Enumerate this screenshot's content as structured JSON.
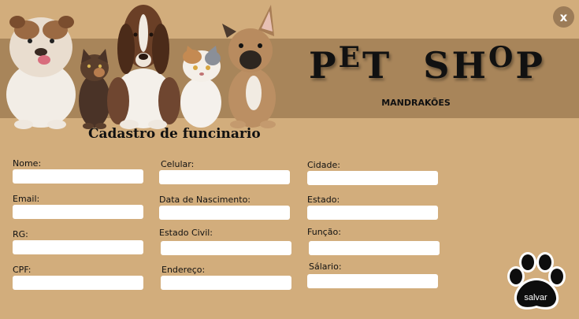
{
  "window": {
    "close_label": "x"
  },
  "brand": {
    "word1": [
      "P",
      "E",
      "T"
    ],
    "word2": [
      "S",
      "H",
      "O",
      "P"
    ],
    "subtitle": "MANDRAKÕES"
  },
  "form": {
    "title": "Cadastro de funcinario",
    "fields": {
      "nome": {
        "label": "Nome:",
        "value": ""
      },
      "email": {
        "label": "Email:",
        "value": ""
      },
      "rg": {
        "label": "RG:",
        "value": ""
      },
      "cpf": {
        "label": "CPF:",
        "value": ""
      },
      "celular": {
        "label": "Celular:",
        "value": ""
      },
      "nascimento": {
        "label": "Data de Nascimento:",
        "value": ""
      },
      "estado_civil": {
        "label": "Estado Civil:",
        "value": ""
      },
      "endereco": {
        "label": "Endereço:",
        "value": ""
      },
      "cidade": {
        "label": "Cidade:",
        "value": ""
      },
      "estado": {
        "label": "Estado:",
        "value": ""
      },
      "funcao": {
        "label": "Função:",
        "value": ""
      },
      "salario": {
        "label": "Sálario:",
        "value": ""
      }
    },
    "save_label": "salvar"
  },
  "colors": {
    "background": "#d2ad7c",
    "banner": "#a8855a",
    "close_button": "#9c7c58",
    "text": "#111111",
    "input": "#ffffff"
  },
  "icons": {
    "close": "close-icon",
    "save": "paw-icon"
  }
}
